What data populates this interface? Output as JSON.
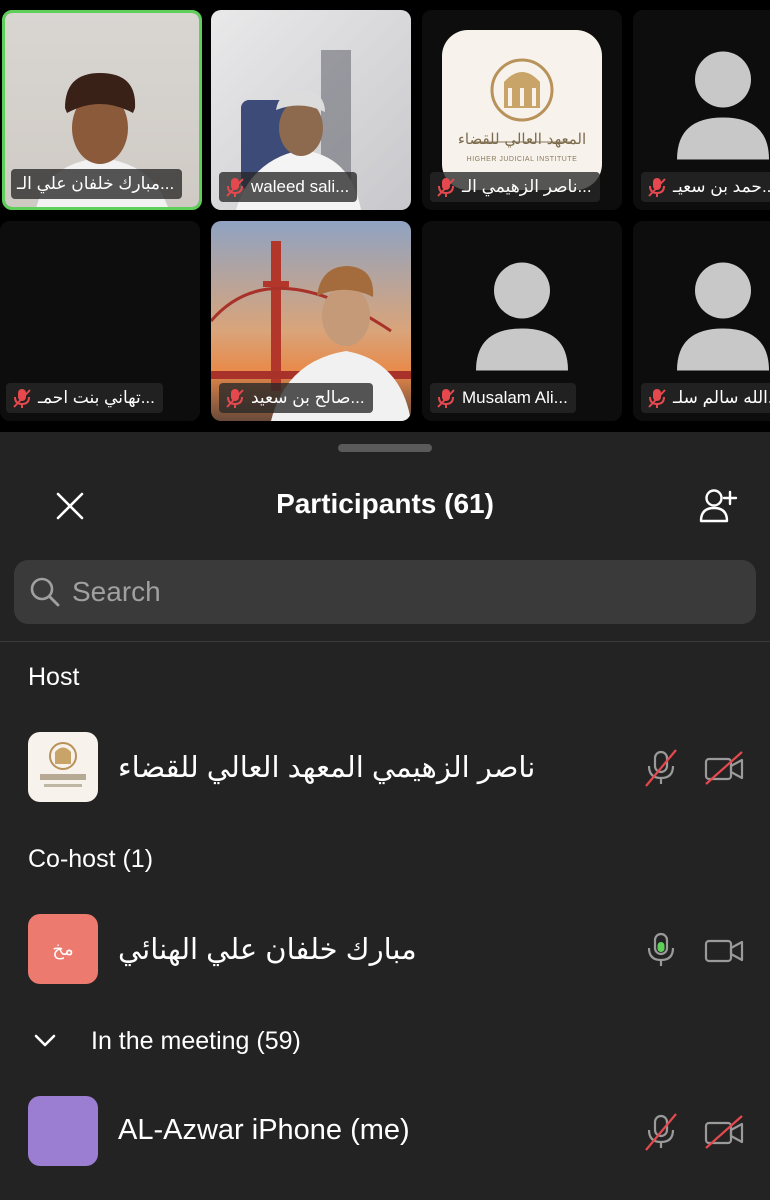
{
  "video_tiles": [
    {
      "name": "مبارك خلفان علي الـ...",
      "active": true,
      "muted": false
    },
    {
      "name": "waleed sali...",
      "active": false,
      "muted": true
    },
    {
      "name": "ناصر الزهيمي الـ...",
      "active": false,
      "muted": true
    },
    {
      "name": "حمد بن سعيـ...",
      "active": false,
      "muted": true
    },
    {
      "name": "تهاني بنت احمـ...",
      "active": false,
      "muted": true
    },
    {
      "name": "صالح بن سعيد...",
      "active": false,
      "muted": true
    },
    {
      "name": "Musalam Ali...",
      "active": false,
      "muted": true
    },
    {
      "name": "الله سالم سلـ...",
      "active": false,
      "muted": true
    }
  ],
  "logo": {
    "arabic": "المعهد العالي للقضاء",
    "english": "HIGHER JUDICIAL INSTITUTE"
  },
  "panel": {
    "title": "Participants (61)",
    "search_placeholder": "Search",
    "host_label": "Host",
    "cohost_label": "Co-host (1)",
    "meeting_label": "In the meeting (59)",
    "host": {
      "name": "ناصر الزهيمي المعهد العالي للقضاء",
      "mic": "muted",
      "video": "off"
    },
    "cohost": {
      "name": "مبارك خلفان علي الهنائي",
      "initials": "مخ",
      "avatar_color": "#ec7a6e",
      "mic": "on",
      "video": "on"
    },
    "me": {
      "name": "AL-Azwar iPhone (me)",
      "avatar_color": "#9b7ed1",
      "mic": "muted",
      "video": "off"
    }
  },
  "colors": {
    "active_border": "#5ed05a",
    "muted_red": "#e5484d",
    "panel_bg": "#232323"
  }
}
